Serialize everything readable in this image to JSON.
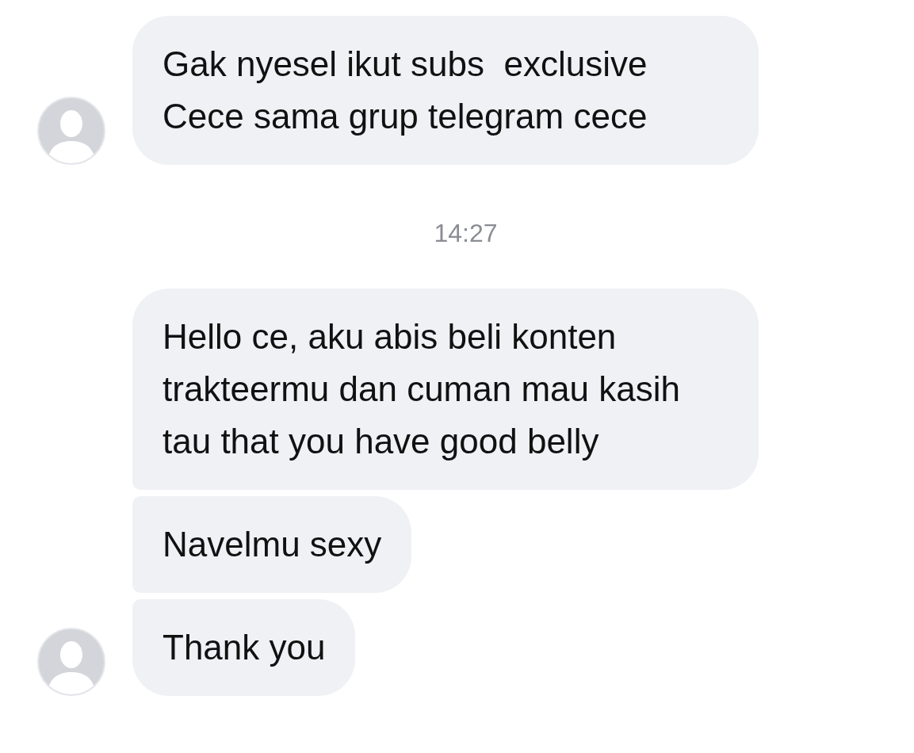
{
  "thread": [
    {
      "kind": "group",
      "messages": [
        "Gak nyesel ikut subs  exclusive Cece sama grup telegram cece"
      ]
    },
    {
      "kind": "time",
      "text": "14:27"
    },
    {
      "kind": "group",
      "messages": [
        "Hello ce, aku abis beli konten trakteermu dan cuman mau kasih tau that you have good belly",
        "Navelmu sexy",
        "Thank you"
      ]
    }
  ]
}
